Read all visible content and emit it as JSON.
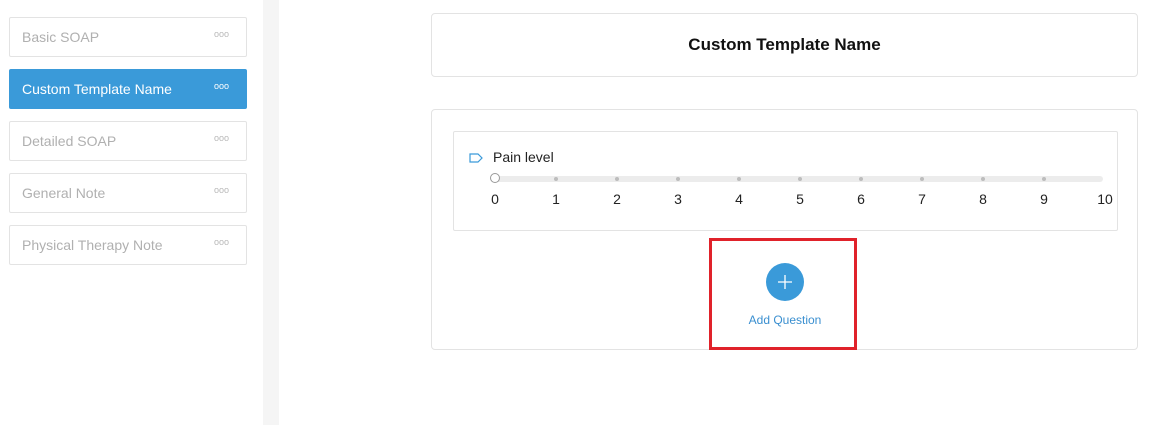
{
  "sidebar": {
    "items": [
      {
        "label": "Basic SOAP",
        "menu_icon": "more-dots-icon",
        "active": false
      },
      {
        "label": "Custom Template Name",
        "menu_icon": "more-dots-icon",
        "active": true
      },
      {
        "label": "Detailed SOAP",
        "menu_icon": "more-dots-icon",
        "active": false
      },
      {
        "label": "General Note",
        "menu_icon": "more-dots-icon",
        "active": false
      },
      {
        "label": "Physical Therapy Note",
        "menu_icon": "more-dots-icon",
        "active": false
      }
    ],
    "dots_glyph": "ooo"
  },
  "template": {
    "title": "Custom Template Name"
  },
  "question": {
    "icon": "tag-icon",
    "label": "Pain level",
    "scale_labels": [
      "0",
      "1",
      "2",
      "3",
      "4",
      "5",
      "6",
      "7",
      "8",
      "9",
      "10"
    ],
    "current_value": 0
  },
  "add_question": {
    "icon": "plus-icon",
    "label": "Add Question"
  },
  "colors": {
    "accent": "#3a9ad9",
    "highlight": "#e0222a"
  }
}
